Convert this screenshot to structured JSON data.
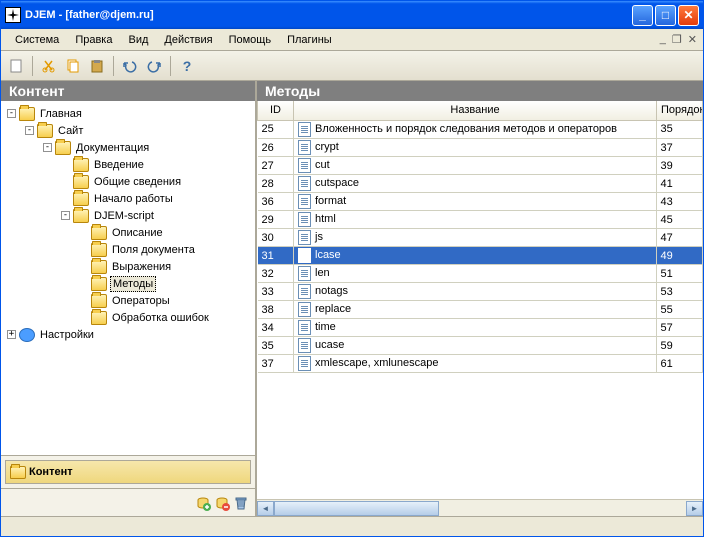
{
  "title": "DJEM - [father@djem.ru]",
  "menu": {
    "system": "Система",
    "edit": "Правка",
    "view": "Вид",
    "actions": "Действия",
    "help": "Помощь",
    "plugins": "Плагины"
  },
  "left": {
    "header": "Контент",
    "tree": {
      "root": "Главная",
      "site": "Сайт",
      "docs": "Документация",
      "intro": "Введение",
      "general": "Общие сведения",
      "start": "Начало работы",
      "script": "DJEM-script",
      "desc": "Описание",
      "fields": "Поля документа",
      "expr": "Выражения",
      "methods": "Методы",
      "ops": "Операторы",
      "errors": "Обработка ошибок",
      "settings": "Настройки"
    },
    "nav_panel": "Контент"
  },
  "right": {
    "header": "Методы",
    "columns": {
      "id": "ID",
      "name": "Название",
      "order": "Порядок"
    },
    "rows": [
      {
        "id": "25",
        "name": "Вложенность и порядок следования методов и операторов",
        "order": "35"
      },
      {
        "id": "26",
        "name": "crypt",
        "order": "37"
      },
      {
        "id": "27",
        "name": "cut",
        "order": "39"
      },
      {
        "id": "28",
        "name": "cutspace",
        "order": "41"
      },
      {
        "id": "36",
        "name": "format",
        "order": "43"
      },
      {
        "id": "29",
        "name": "html",
        "order": "45"
      },
      {
        "id": "30",
        "name": "js",
        "order": "47"
      },
      {
        "id": "31",
        "name": "lcase",
        "order": "49",
        "selected": true
      },
      {
        "id": "32",
        "name": "len",
        "order": "51"
      },
      {
        "id": "33",
        "name": "notags",
        "order": "53"
      },
      {
        "id": "38",
        "name": "replace",
        "order": "55"
      },
      {
        "id": "34",
        "name": "time",
        "order": "57"
      },
      {
        "id": "35",
        "name": "ucase",
        "order": "59"
      },
      {
        "id": "37",
        "name": "xmlescape, xmlunescape",
        "order": "61"
      }
    ]
  }
}
